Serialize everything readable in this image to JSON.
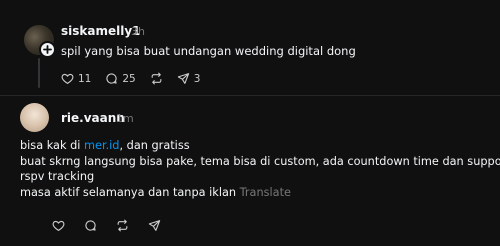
{
  "post": {
    "username": "siskamelly1",
    "time": "3h",
    "text": "spil yang bisa buat undangan wedding digital dong",
    "likes": "11",
    "comments": "25",
    "shares": "3"
  },
  "reply": {
    "username": "rie.vaann",
    "time": "1m",
    "line1_prefix": "bisa kak di ",
    "line1_link": "mer.id",
    "line1_suffix": ", dan gratiss",
    "line2": "buat skrng langsung bisa pake, tema bisa di custom, ada countdown time dan support",
    "line3": "rspv tracking",
    "line4": "masa aktif selamanya dan tanpa iklan",
    "translate": "Translate"
  },
  "icons": {
    "like": "heart-icon",
    "comment": "comment-icon",
    "repost": "repost-icon",
    "share": "share-icon",
    "follow": "plus-icon"
  },
  "colors": {
    "background": "#101010",
    "text": "#f3f5f7",
    "muted": "#777777",
    "link": "#0095f6"
  }
}
